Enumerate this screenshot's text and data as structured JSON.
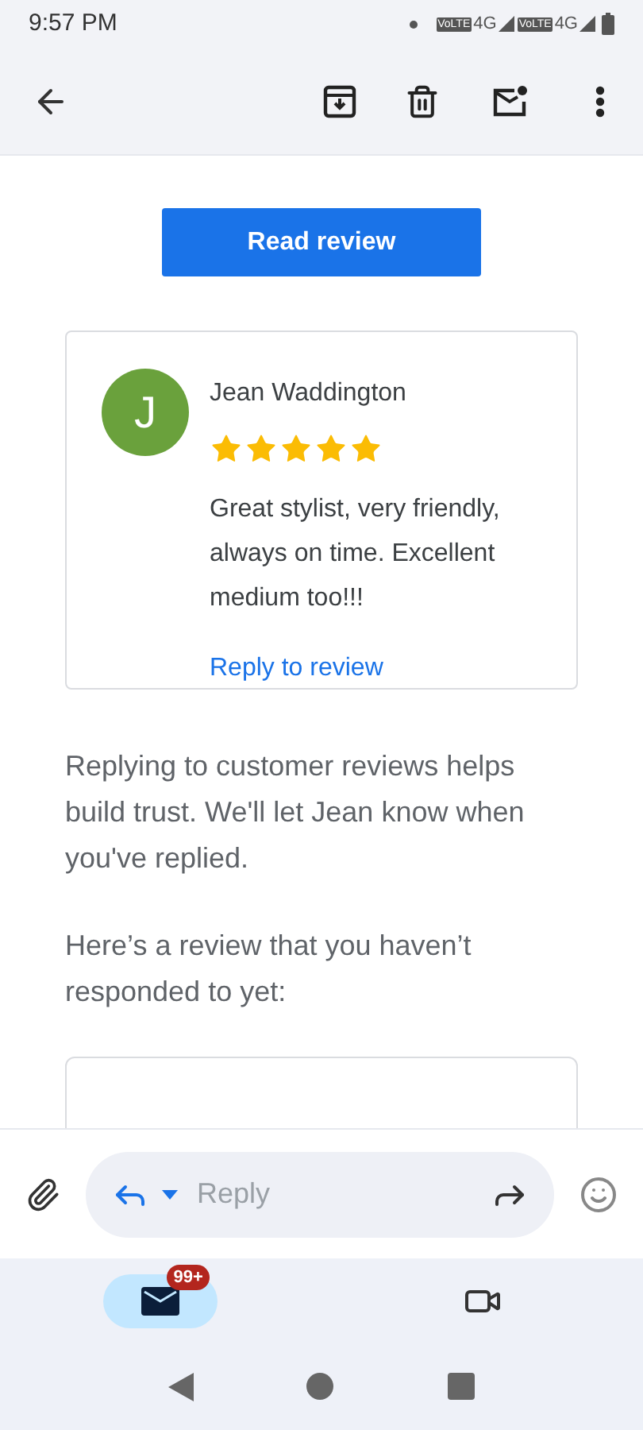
{
  "status_bar": {
    "time": "9:57 PM",
    "network": [
      {
        "badge": "VoLTE",
        "type": "4G"
      },
      {
        "badge": "VoLTE",
        "type": "4G"
      }
    ]
  },
  "read_review_button": "Read review",
  "review": {
    "initial": "J",
    "name": "Jean Waddington",
    "stars": 5,
    "text": "Great stylist, very friendly, always on time. Excellent medium too!!!",
    "reply_link": "Reply to review"
  },
  "paragraphs": [
    "Replying to customer reviews helps build trust. We'll let Jean know when you've replied.",
    "Here’s a review that you haven’t responded to yet:"
  ],
  "reply_bar": {
    "placeholder": "Reply"
  },
  "bottom_nav": [
    {
      "kind": "mail",
      "selected": true,
      "badge": "99+"
    },
    {
      "kind": "video",
      "selected": false
    }
  ]
}
